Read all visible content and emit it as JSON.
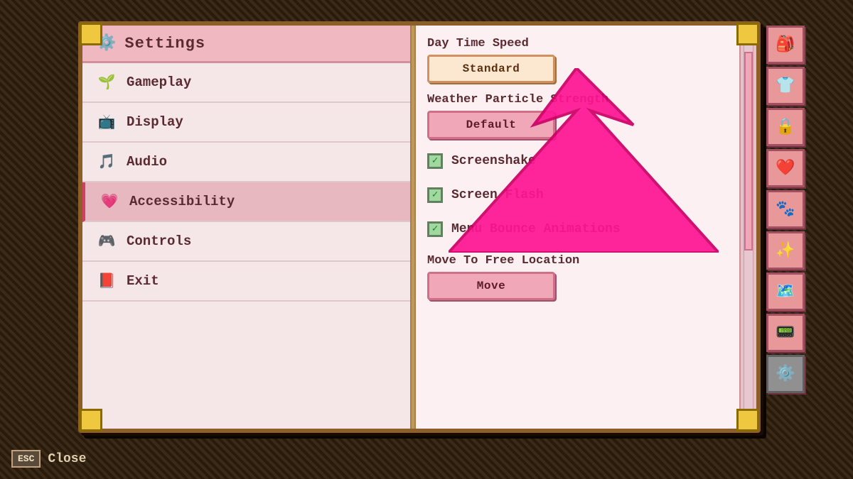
{
  "app": {
    "title": "Settings",
    "close_key": "ESC",
    "close_label": "Close"
  },
  "sidebar": {
    "items": [
      {
        "id": "gameplay",
        "label": "Gameplay",
        "icon": "🌱"
      },
      {
        "id": "display",
        "label": "Display",
        "icon": "📺"
      },
      {
        "id": "audio",
        "label": "Audio",
        "icon": "🎵"
      },
      {
        "id": "accessibility",
        "label": "Accessibility",
        "icon": "💗",
        "active": true
      },
      {
        "id": "controls",
        "label": "Controls",
        "icon": "🎮"
      },
      {
        "id": "exit",
        "label": "Exit",
        "icon": "📕"
      }
    ]
  },
  "right_panel": {
    "sections": [
      {
        "id": "day-time-speed",
        "label": "Day Time Speed",
        "type": "button",
        "value": "Standard"
      },
      {
        "id": "weather-particles",
        "label": "Weather Particle Strength",
        "type": "button",
        "value": "Default"
      },
      {
        "id": "screenshake",
        "label": "Screenshake",
        "type": "checkbox",
        "checked": true
      },
      {
        "id": "screen-flash",
        "label": "Screen Flash",
        "type": "checkbox",
        "checked": true
      },
      {
        "id": "menu-bounce",
        "label": "Menu Bounce Animations",
        "type": "checkbox",
        "checked": true
      },
      {
        "id": "move-location",
        "label": "Move To Free Location",
        "type": "button",
        "value": "Move"
      }
    ]
  },
  "right_sidebar_icons": [
    "🎒",
    "👕",
    "🔒",
    "❤️",
    "🐾",
    "✨",
    "🗺️",
    "📟",
    "⚙️"
  ],
  "arrow": {
    "visible": true
  }
}
